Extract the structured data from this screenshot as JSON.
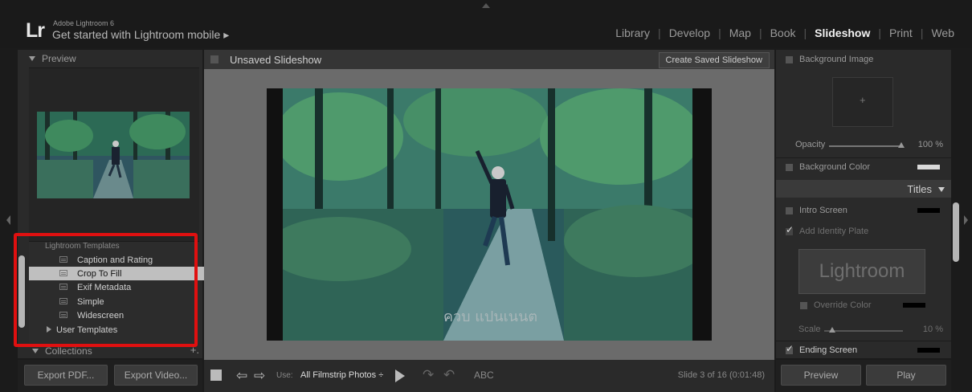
{
  "top": {
    "logo": "Lr",
    "app_name": "Adobe Lightroom 6",
    "mobile_link": "Get started with Lightroom mobile ▸",
    "modules": [
      "Library",
      "Develop",
      "Map",
      "Book",
      "Slideshow",
      "Print",
      "Web"
    ],
    "active_module": "Slideshow"
  },
  "left_panel": {
    "preview_header": "Preview",
    "template_group": "Lightroom Templates",
    "templates": [
      "Caption and Rating",
      "Crop To Fill",
      "Exif Metadata",
      "Simple",
      "Widescreen"
    ],
    "selected_template": "Crop To Fill",
    "user_templates": "User Templates",
    "collections_header": "Collections",
    "collections_add": "+.",
    "export_pdf": "Export PDF...",
    "export_video": "Export Video..."
  },
  "center": {
    "title": "Unsaved Slideshow",
    "save_button": "Create Saved Slideshow",
    "slide_watermark": "ควบ แปนเนนต",
    "toolbar": {
      "use_label": "Use:",
      "use_value": "All Filmstrip Photos ÷",
      "text_tool": "ABC",
      "slide_count": "Slide 3 of 16 (0:01:48)"
    }
  },
  "right_panel": {
    "background_image": "Background Image",
    "opacity_label": "Opacity",
    "opacity_value": "100 %",
    "opacity_fraction": 1.0,
    "background_color": "Background Color",
    "titles_header": "Titles",
    "intro_screen": "Intro Screen",
    "add_identity_plate": "Add Identity Plate",
    "identity_plate_text": "Lightroom",
    "override_color": "Override Color",
    "scale_label": "Scale",
    "scale_value": "10 %",
    "scale_fraction": 0.1,
    "ending_screen": "Ending Screen",
    "preview_button": "Preview",
    "play_button": "Play"
  },
  "colors": {
    "highlight_box": "#e01010",
    "selected_row": "#bfbfbf",
    "stage_gray": "#6b6b6b"
  }
}
